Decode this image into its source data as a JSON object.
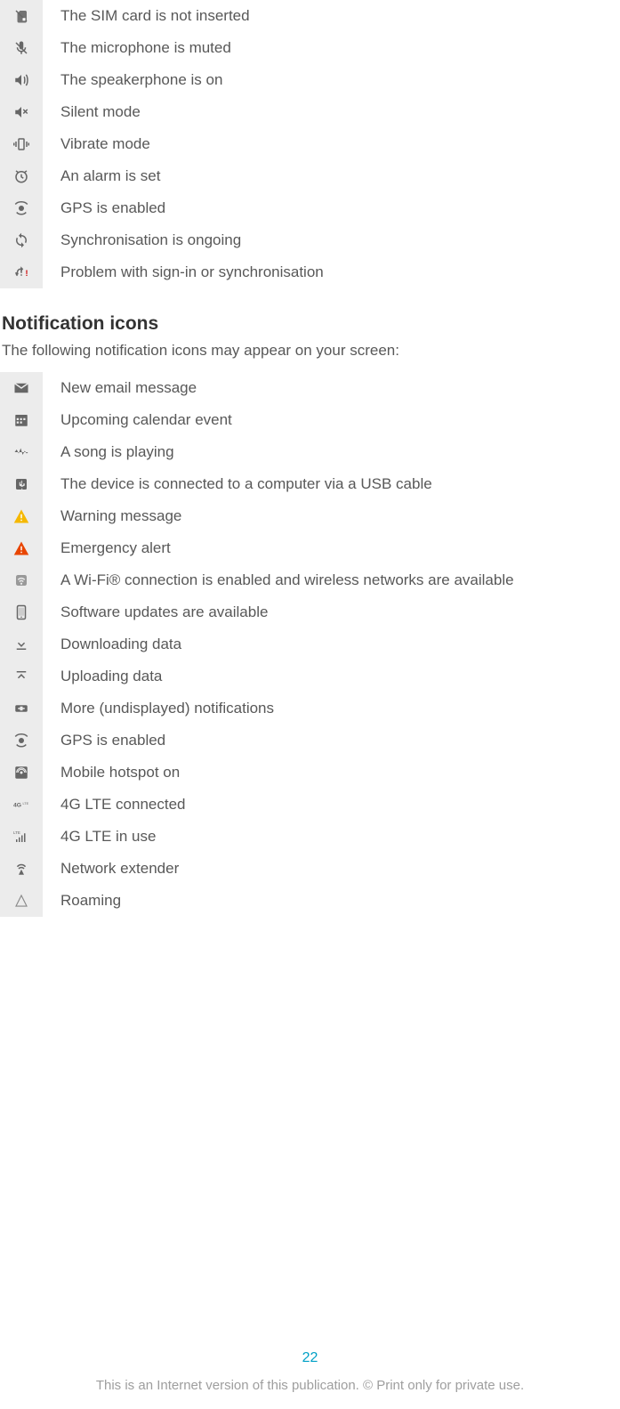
{
  "status_rows": [
    {
      "icon": "no-sim-icon",
      "label": "The SIM card is not inserted"
    },
    {
      "icon": "mic-muted-icon",
      "label": "The microphone is muted"
    },
    {
      "icon": "speakerphone-icon",
      "label": "The speakerphone is on"
    },
    {
      "icon": "silent-mode-icon",
      "label": "Silent mode"
    },
    {
      "icon": "vibrate-mode-icon",
      "label": "Vibrate mode"
    },
    {
      "icon": "alarm-icon",
      "label": "An alarm is set"
    },
    {
      "icon": "gps-icon",
      "label": "GPS is enabled"
    },
    {
      "icon": "sync-icon",
      "label": "Synchronisation is ongoing"
    },
    {
      "icon": "sync-problem-icon",
      "label": "Problem with sign-in or synchronisation"
    }
  ],
  "notification_heading": "Notification icons",
  "notification_sub": "The following notification icons may appear on your screen:",
  "notification_rows": [
    {
      "icon": "email-icon",
      "label": "New email message"
    },
    {
      "icon": "calendar-icon",
      "label": "Upcoming calendar event"
    },
    {
      "icon": "music-icon",
      "label": "A song is playing"
    },
    {
      "icon": "usb-icon",
      "label": "The device is connected to a computer via a USB cable"
    },
    {
      "icon": "warning-yellow-icon",
      "label": "Warning message"
    },
    {
      "icon": "warning-red-icon",
      "label": "Emergency alert"
    },
    {
      "icon": "wifi-icon",
      "label": "A Wi-Fi® connection is enabled and wireless networks are available"
    },
    {
      "icon": "software-update-icon",
      "label": "Software updates are available"
    },
    {
      "icon": "download-icon",
      "label": "Downloading data"
    },
    {
      "icon": "upload-icon",
      "label": "Uploading data"
    },
    {
      "icon": "more-notifications-icon",
      "label": "More (undisplayed) notifications"
    },
    {
      "icon": "gps-icon",
      "label": "GPS is enabled"
    },
    {
      "icon": "hotspot-icon",
      "label": "Mobile hotspot on"
    },
    {
      "icon": "lte-connected-icon",
      "label": "4G LTE connected"
    },
    {
      "icon": "lte-inuse-icon",
      "label": "4G LTE in use"
    },
    {
      "icon": "network-extender-icon",
      "label": "Network extender"
    },
    {
      "icon": "roaming-icon",
      "label": "Roaming"
    }
  ],
  "page_number": "22",
  "footer": "This is an Internet version of this publication. © Print only for private use."
}
